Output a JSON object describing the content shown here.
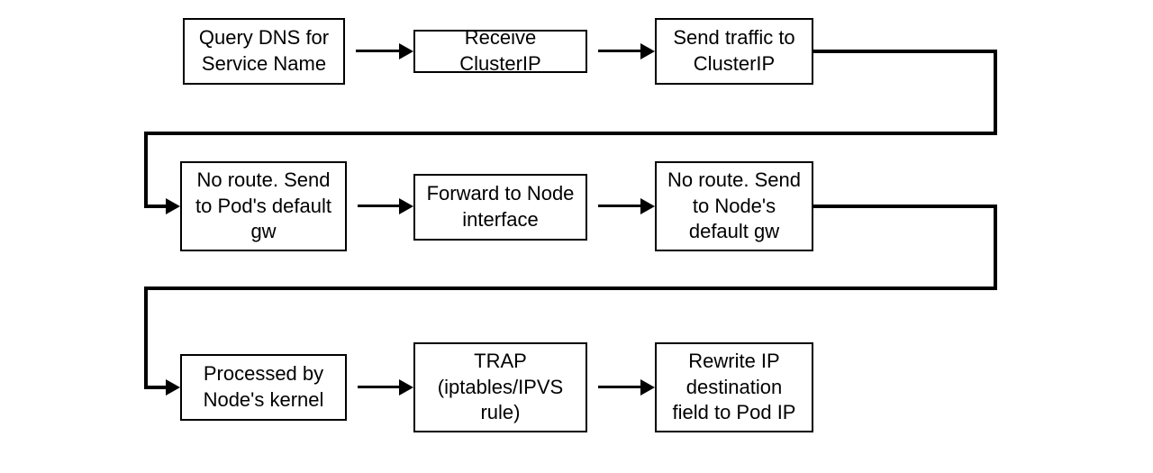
{
  "flow": {
    "row1": {
      "step1": "Query DNS for Service Name",
      "step2": "Receive ClusterIP",
      "step3": "Send traffic to ClusterIP"
    },
    "row2": {
      "step1": "No route. Send to Pod's default gw",
      "step2": "Forward to Node interface",
      "step3": "No route. Send to Node's default gw"
    },
    "row3": {
      "step1": "Processed by Node's kernel",
      "step2": "TRAP (iptables/IPVS rule)",
      "step3": "Rewrite IP destination field to Pod IP"
    }
  }
}
